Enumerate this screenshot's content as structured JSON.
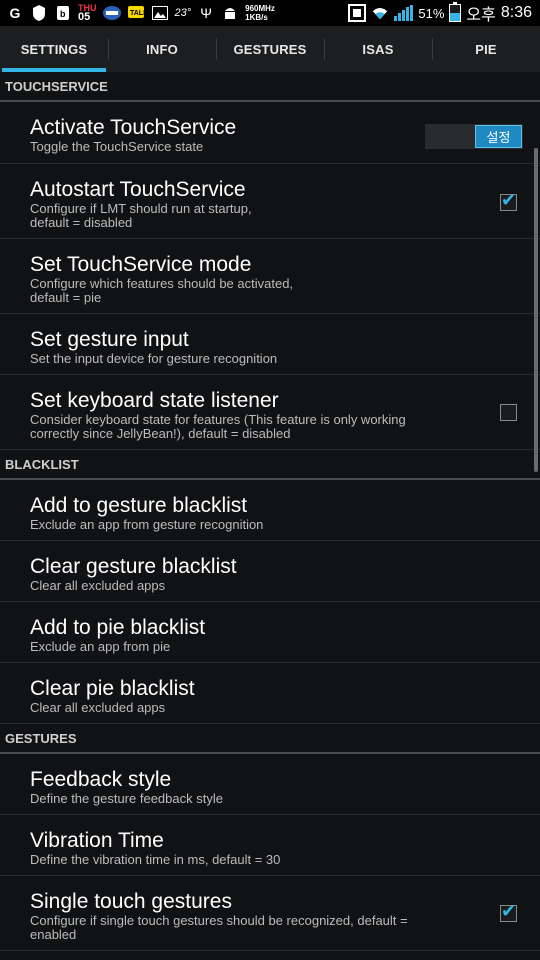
{
  "status_bar": {
    "day_name": "THU",
    "day_number": "05",
    "temperature": "23°",
    "speed_line1": "960MHz",
    "speed_line2": "1KB/s",
    "battery_percent": "51%",
    "ampm": "오후",
    "time": "8:36"
  },
  "tabs": [
    {
      "label": "SETTINGS",
      "active": true
    },
    {
      "label": "INFO",
      "active": false
    },
    {
      "label": "GESTURES",
      "active": false
    },
    {
      "label": "ISAS",
      "active": false
    },
    {
      "label": "PIE",
      "active": false
    }
  ],
  "sections": {
    "touchservice": "TOUCHSERVICE",
    "blacklist": "BLACKLIST",
    "gestures": "GESTURES"
  },
  "items": {
    "activate": {
      "title": "Activate TouchService",
      "summary": "Toggle the TouchService state",
      "toggle_label": "설정",
      "toggle_on": true
    },
    "autostart": {
      "title": "Autostart TouchService",
      "summary_line1": "Configure if LMT should run at startup,",
      "summary_line2": "default = disabled",
      "checked": true
    },
    "mode": {
      "title": "Set TouchService mode",
      "summary_line1": "Configure which features should be activated,",
      "summary_line2": "default = pie"
    },
    "gesture_input": {
      "title": "Set gesture input",
      "summary": "Set the input device for gesture recognition"
    },
    "keyboard": {
      "title": "Set keyboard state listener",
      "summary_line1": "Consider keyboard state for features (This feature is only working",
      "summary_line2": "correctly since JellyBean!), default = disabled",
      "checked": false
    },
    "add_gesture_bl": {
      "title": "Add to gesture blacklist",
      "summary": "Exclude an app from gesture recognition"
    },
    "clear_gesture_bl": {
      "title": "Clear gesture blacklist",
      "summary": "Clear all excluded apps"
    },
    "add_pie_bl": {
      "title": "Add to pie blacklist",
      "summary": "Exclude an app from pie"
    },
    "clear_pie_bl": {
      "title": "Clear pie blacklist",
      "summary": "Clear all excluded apps"
    },
    "feedback": {
      "title": "Feedback style",
      "summary": "Define the gesture feedback style"
    },
    "vibration": {
      "title": "Vibration Time",
      "summary": "Define the vibration time in ms, default = 30"
    },
    "single_touch": {
      "title": "Single touch gestures",
      "summary_line1": "Configure if single touch gestures should be recognized, default =",
      "summary_line2": "enabled",
      "checked": true
    }
  },
  "colors": {
    "accent": "#33b5e5",
    "background": "#111214",
    "tab_bar": "#1d1e20"
  }
}
